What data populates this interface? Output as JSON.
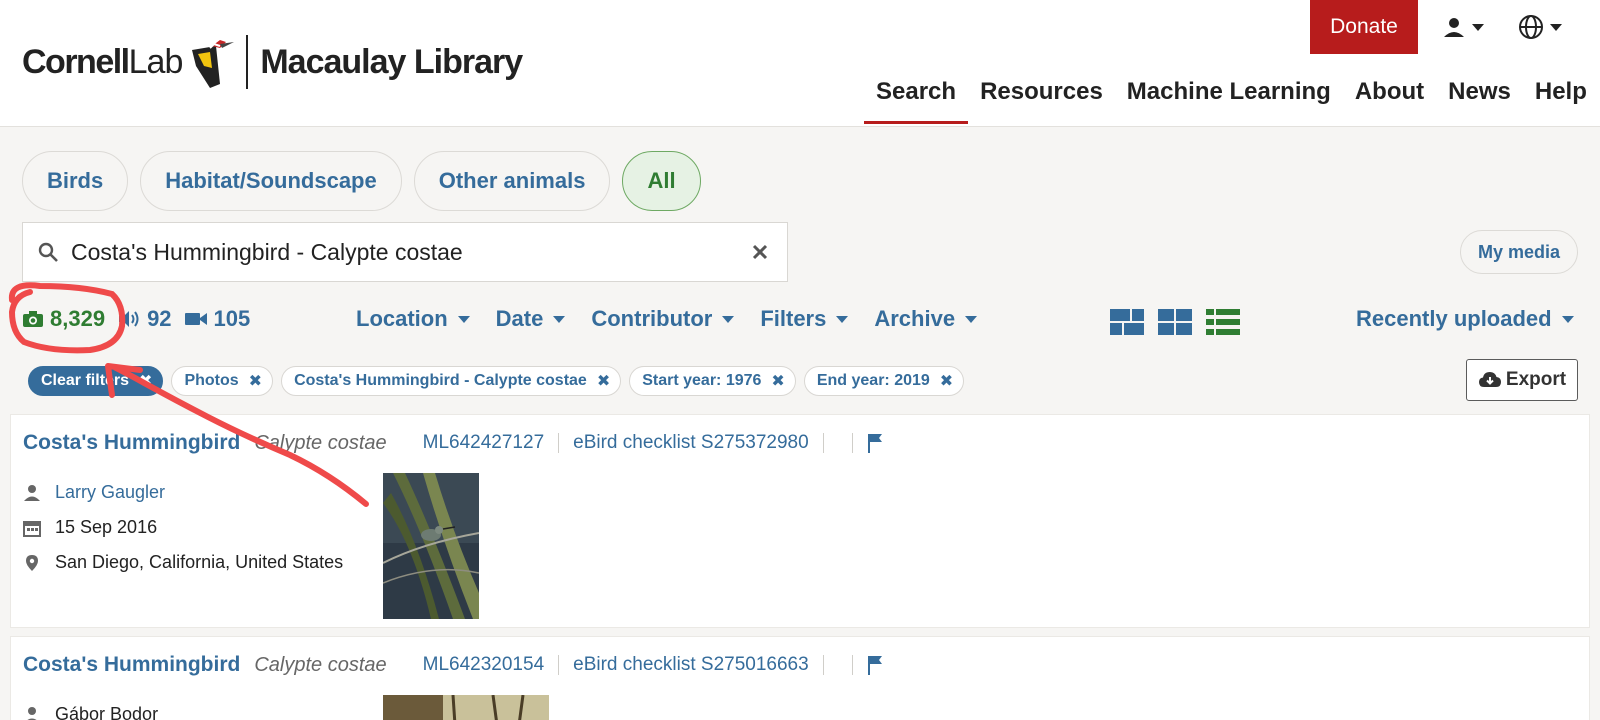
{
  "brand": {
    "cornell": "Cornell",
    "lab": "Lab",
    "macaulay": "Macaulay Library"
  },
  "topbar": {
    "donate": "Donate"
  },
  "nav": {
    "search": "Search",
    "resources": "Resources",
    "ml": "Machine Learning",
    "about": "About",
    "news": "News",
    "help": "Help",
    "active": "Search"
  },
  "tabs": {
    "birds": "Birds",
    "habitat": "Habitat/Soundscape",
    "other": "Other animals",
    "all": "All",
    "active": "All"
  },
  "search": {
    "value": "Costa's Hummingbird - Calypte costae"
  },
  "mymedia": "My media",
  "counts": {
    "photos": "8,329",
    "audio": "92",
    "video": "105"
  },
  "filters": {
    "location": "Location",
    "date": "Date",
    "contributor": "Contributor",
    "filters": "Filters",
    "archive": "Archive"
  },
  "sort": "Recently uploaded",
  "chips": {
    "clear": "Clear filters",
    "photos": "Photos",
    "species": "Costa's Hummingbird - Calypte costae",
    "start": "Start year: 1976",
    "end": "End year: 2019"
  },
  "export": "Export",
  "results": [
    {
      "common": "Costa's Hummingbird",
      "sci": "Calypte costae",
      "ml": "ML642427127",
      "checklist": "eBird checklist S275372980",
      "observer": "Larry Gaugler",
      "date": "15 Sep 2016",
      "location": "San Diego, California, United States"
    },
    {
      "common": "Costa's Hummingbird",
      "sci": "Calypte costae",
      "ml": "ML642320154",
      "checklist": "eBird checklist S275016663",
      "observer": "Gábor Bodor"
    }
  ],
  "colors": {
    "accent_red": "#b71c1c",
    "link_blue": "#356c9b",
    "green": "#2f7d32",
    "annotation": "#ef4a4a"
  }
}
